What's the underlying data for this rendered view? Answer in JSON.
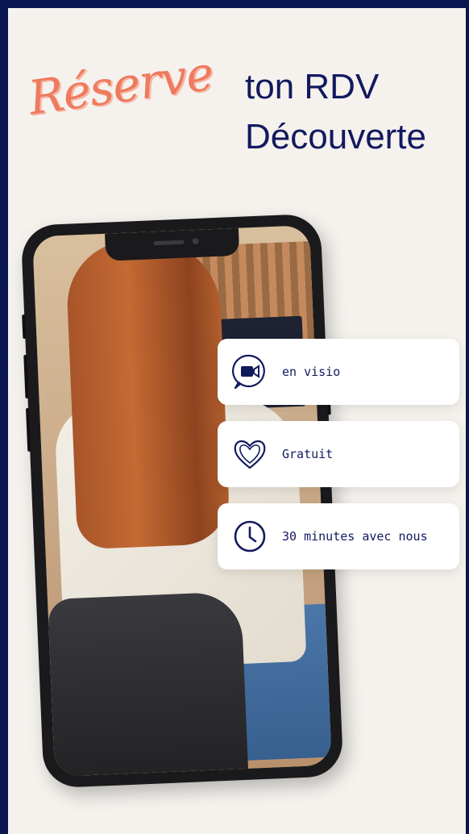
{
  "heading": {
    "script_word": "Réserve",
    "line1": "ton RDV",
    "line2": "Découverte"
  },
  "features": [
    {
      "icon": "video-chat-icon",
      "label": "en visio"
    },
    {
      "icon": "heart-icon",
      "label": "Gratuit"
    },
    {
      "icon": "clock-icon",
      "label": "30 minutes avec nous"
    }
  ],
  "colors": {
    "frame": "#0a1650",
    "background": "#f5f2ee",
    "navy_text": "#121a5e",
    "script_accent": "#ef7a5e"
  }
}
